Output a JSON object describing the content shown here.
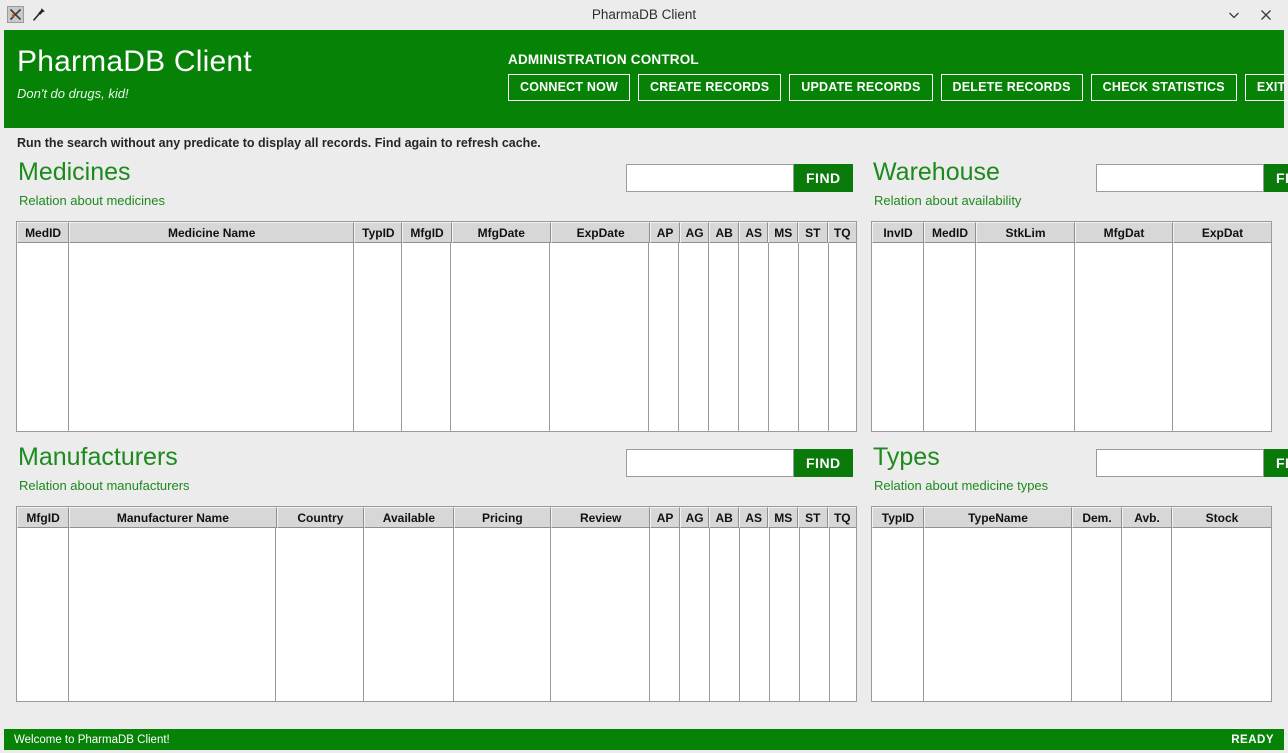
{
  "window": {
    "title": "PharmaDB Client",
    "app_icon": "x-logo-icon",
    "pin_icon": "pin-icon",
    "minimize_icon": "chevron-down-icon",
    "close_icon": "close-icon"
  },
  "banner": {
    "brand_title": "PharmaDB Client",
    "brand_subtitle": "Don't do drugs, kid!",
    "admin_label": "ADMINISTRATION CONTROL",
    "admin_buttons": [
      "CONNECT NOW",
      "CREATE RECORDS",
      "UPDATE RECORDS",
      "DELETE RECORDS",
      "CHECK STATISTICS",
      "EXIT"
    ],
    "background_color": "#068206"
  },
  "hint": "Run the search without any predicate to display all records. Find again to refresh cache.",
  "find_label": "FIND",
  "search_placeholder": "",
  "panels": {
    "medicines": {
      "title": "Medicines",
      "subtitle": "Relation about medicines",
      "search_value": "",
      "columns": [
        "MedID",
        "Medicine Name",
        "TypID",
        "MfgID",
        "MfgDate",
        "ExpDate",
        "AP",
        "AG",
        "AB",
        "AS",
        "MS",
        "ST",
        "TQ"
      ],
      "rows": []
    },
    "warehouse": {
      "title": "Warehouse",
      "subtitle": "Relation about availability",
      "search_value": "",
      "columns": [
        "InvID",
        "MedID",
        "StkLim",
        "MfgDat",
        "ExpDat"
      ],
      "rows": []
    },
    "manufacturers": {
      "title": "Manufacturers",
      "subtitle": "Relation about manufacturers",
      "search_value": "",
      "columns": [
        "MfgID",
        "Manufacturer Name",
        "Country",
        "Available",
        "Pricing",
        "Review",
        "AP",
        "AG",
        "AB",
        "AS",
        "MS",
        "ST",
        "TQ"
      ],
      "rows": []
    },
    "types": {
      "title": "Types",
      "subtitle": "Relation about medicine types",
      "search_value": "",
      "columns": [
        "TypID",
        "TypeName",
        "Dem.",
        "Avb.",
        "Stock"
      ],
      "rows": []
    }
  },
  "statusbar": {
    "message": "Welcome to PharmaDB Client!",
    "state": "READY"
  },
  "colors": {
    "brand_green": "#068206",
    "title_green": "#1d8a1d",
    "find_green": "#0a7a0a",
    "chrome_gray": "#ececec"
  }
}
